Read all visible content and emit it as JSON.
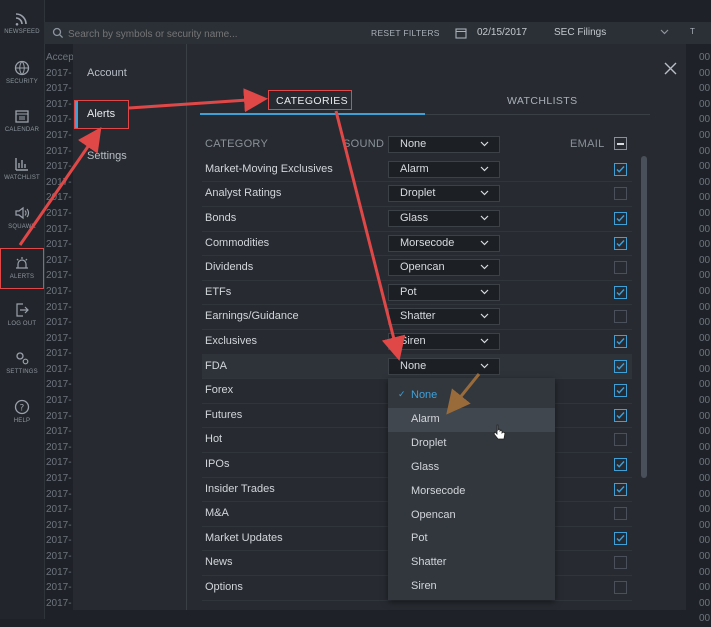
{
  "sidebar": {
    "items": [
      {
        "label": "NEWSFEED",
        "icon": "rss-icon"
      },
      {
        "label": "SECURITY",
        "icon": "globe-icon"
      },
      {
        "label": "CALENDAR",
        "icon": "calendar-icon"
      },
      {
        "label": "WATCHLIST",
        "icon": "bar-chart-icon"
      },
      {
        "label": "SQUAWK",
        "icon": "speaker-icon"
      },
      {
        "label": "ALERTS",
        "icon": "alarm-icon"
      },
      {
        "label": "LOG OUT",
        "icon": "logout-icon"
      },
      {
        "label": "SETTINGS",
        "icon": "gears-icon"
      },
      {
        "label": "HELP",
        "icon": "help-icon"
      }
    ]
  },
  "topbar": {
    "search_placeholder": "Search by symbols or security name...",
    "reset_label": "RESET FILTERS",
    "date": "02/15/2017",
    "filing_type": "SEC Filings",
    "right_label": "T"
  },
  "background": {
    "column_header": "Accep",
    "row_prefix": "2017-",
    "right_values": [
      "00",
      "00",
      "00",
      "00",
      "00",
      "00",
      "00",
      "00",
      "00",
      "00",
      "00",
      "00",
      "00",
      "00",
      "00",
      "00",
      "00",
      "00",
      "00",
      "00",
      "00",
      "00",
      "00",
      "00",
      "00",
      "00",
      "00",
      "00",
      "00",
      "00",
      "00",
      "00",
      "00",
      "00",
      "00",
      "00",
      "00"
    ]
  },
  "settings_nav": {
    "account": "Account",
    "alerts": "Alerts",
    "settings": "Settings"
  },
  "tabs": {
    "categories": "CATEGORIES",
    "watchlists": "WATCHLISTS"
  },
  "table": {
    "header_category": "CATEGORY",
    "header_sound": "SOUND",
    "header_sound_value": "None",
    "header_email": "EMAIL",
    "rows": [
      {
        "label": "Market-Moving Exclusives",
        "sound": "Alarm",
        "email": true
      },
      {
        "label": "Analyst Ratings",
        "sound": "Droplet",
        "email": false
      },
      {
        "label": "Bonds",
        "sound": "Glass",
        "email": true
      },
      {
        "label": "Commodities",
        "sound": "Morsecode",
        "email": true
      },
      {
        "label": "Dividends",
        "sound": "Opencan",
        "email": false
      },
      {
        "label": "ETFs",
        "sound": "Pot",
        "email": true
      },
      {
        "label": "Earnings/Guidance",
        "sound": "Shatter",
        "email": false
      },
      {
        "label": "Exclusives",
        "sound": "Siren",
        "email": true
      },
      {
        "label": "FDA",
        "sound": "None",
        "email": true
      },
      {
        "label": "Forex",
        "sound": "",
        "email": true
      },
      {
        "label": "Futures",
        "sound": "",
        "email": true
      },
      {
        "label": "Hot",
        "sound": "",
        "email": false
      },
      {
        "label": "IPOs",
        "sound": "",
        "email": true
      },
      {
        "label": "Insider Trades",
        "sound": "",
        "email": true
      },
      {
        "label": "M&A",
        "sound": "",
        "email": false
      },
      {
        "label": "Market Updates",
        "sound": "",
        "email": true
      },
      {
        "label": "News",
        "sound": "",
        "email": false
      },
      {
        "label": "Options",
        "sound": "",
        "email": false
      }
    ]
  },
  "dropdown": {
    "options": [
      "None",
      "Alarm",
      "Droplet",
      "Glass",
      "Morsecode",
      "Opencan",
      "Pot",
      "Shatter",
      "Siren"
    ],
    "selected": "None",
    "hovered": "Alarm"
  },
  "colors": {
    "accent": "#3fa0d8",
    "annotation": "#e04848"
  }
}
